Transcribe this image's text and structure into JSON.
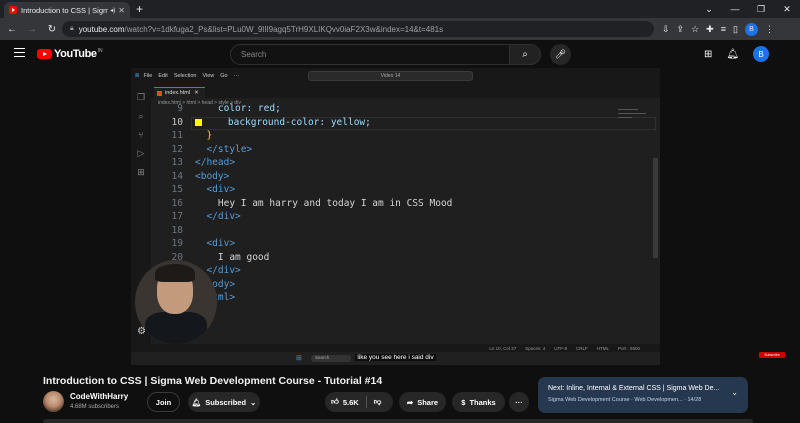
{
  "browser": {
    "tab_title": "Introduction to CSS | Sigma",
    "new_tab_icon": "+",
    "window_controls": [
      "—",
      "❐",
      "✕"
    ],
    "url_domain": "youtube.com",
    "url_path": "/watch?v=1dkfuga2_Ps&list=PLu0W_9lII9agq5TrH9XLIKQvv0iaF2X3w&index=14&t=481s",
    "profile_initial": "B"
  },
  "youtube": {
    "logo_text": "YouTube",
    "country_code": "IN",
    "search_placeholder": "Search",
    "avatar_initial": "B"
  },
  "video": {
    "editor_menu": [
      "File",
      "Edit",
      "Selection",
      "View",
      "Go",
      "···"
    ],
    "editor_search": "Video 14",
    "file_tab": "index.html",
    "breadcrumb": "index.html > html > head > style > div",
    "lines": [
      {
        "num": "9",
        "text": "    color: red;"
      },
      {
        "num": "10",
        "text": "    background-color: yellow;"
      },
      {
        "num": "11",
        "text": "  }"
      },
      {
        "num": "12",
        "text": "  </style>"
      },
      {
        "num": "13",
        "text": "</head>"
      },
      {
        "num": "14",
        "text": "<body>"
      },
      {
        "num": "15",
        "text": "  <div>"
      },
      {
        "num": "16",
        "text": "    Hey I am harry and today I am in CSS Mood"
      },
      {
        "num": "17",
        "text": "  </div>"
      },
      {
        "num": "18",
        "text": ""
      },
      {
        "num": "19",
        "text": "  <div>"
      },
      {
        "num": "20",
        "text": "    I am good"
      },
      {
        "num": "21",
        "text": "  </div>"
      },
      {
        "num": "22",
        "text": "</body>"
      },
      {
        "num": "23",
        "text": "</html>"
      }
    ],
    "status_items": [
      "Ln 10, Col 37",
      "Spaces: 4",
      "UTF-8",
      "CRLF",
      "HTML",
      "Port : 5500"
    ],
    "taskbar_search": "Search",
    "subtitle": "like you see here i said div",
    "subscribe_badge": "Subscribe"
  },
  "info": {
    "title": "Introduction to CSS | Sigma Web Development Course - Tutorial #14",
    "channel": "CodeWithHarry",
    "subscribers": "4.68M subscribers",
    "join_label": "Join",
    "subscribed_label": "Subscribed",
    "likes": "5.6K",
    "share_label": "Share",
    "thanks_label": "Thanks",
    "more_label": "···"
  },
  "next": {
    "title": "Next: Inline, Internal & External CSS | Sigma Web De...",
    "subtitle": "Sigma Web Development Course · Web Developmen... · 14/28"
  },
  "colors": {
    "accent_red": "#ff0000",
    "next_card_bg": "#263850",
    "code_tag": "#569cd6",
    "code_prop": "#9cdcfe"
  }
}
